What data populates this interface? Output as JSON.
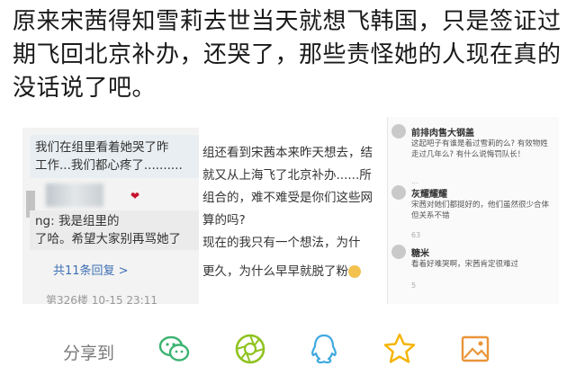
{
  "headline": "原来宋茜得知雪莉去世当天就想飞韩国，只是签证过期飞回北京补办，还哭了，那些责怪她的人现在真的没话说了吧。",
  "screenshot1": {
    "line1": "我们在组里看着她哭了昨",
    "line2": "工作...我们都心疼了..........",
    "reply_line1": "ng: 我是组里的",
    "reply_line2": "了哈。希望大家别再骂她了",
    "more_replies": "共11条回复 >",
    "meta": "第326楼 10-15 23:11"
  },
  "screenshot2": {
    "line1": "组还看到宋茜本来昨天想去，结",
    "line2": "就又从上海飞了北京补办......所",
    "line3": "组合的，难不难受是你们这些网",
    "line4": "算的吗?",
    "line5": "现在的我只有一个想法，为什",
    "line6": "更久，为什么早早就脱了粉"
  },
  "screenshot3": {
    "comments": [
      {
        "name": "前排肉售大钢盖",
        "body": "这起吧子有谁是着过雪莉的么? 有效物姓走过几年么? 有什么说悔罚队长！",
        "icon": "...",
        "time": ""
      },
      {
        "name": "灰耀耀耀",
        "body": "宋茜对她们都挺好的，他们虽然很少合体但关系不错",
        "icon": "63",
        "time": ""
      },
      {
        "name": "糖米",
        "body": "看着好难哭啊，宋茜肯定很难过",
        "icon": "5",
        "time": ""
      }
    ]
  },
  "share": {
    "label": "分享到",
    "icons": [
      "wechat-icon",
      "moments-icon",
      "qq-icon",
      "favorite-star-icon",
      "image-icon"
    ],
    "colors": {
      "wechat": "#3cb371",
      "moments": "#8fc31f",
      "qq": "#3fa9e0",
      "star": "#f5b400",
      "image": "#e9953a"
    }
  }
}
